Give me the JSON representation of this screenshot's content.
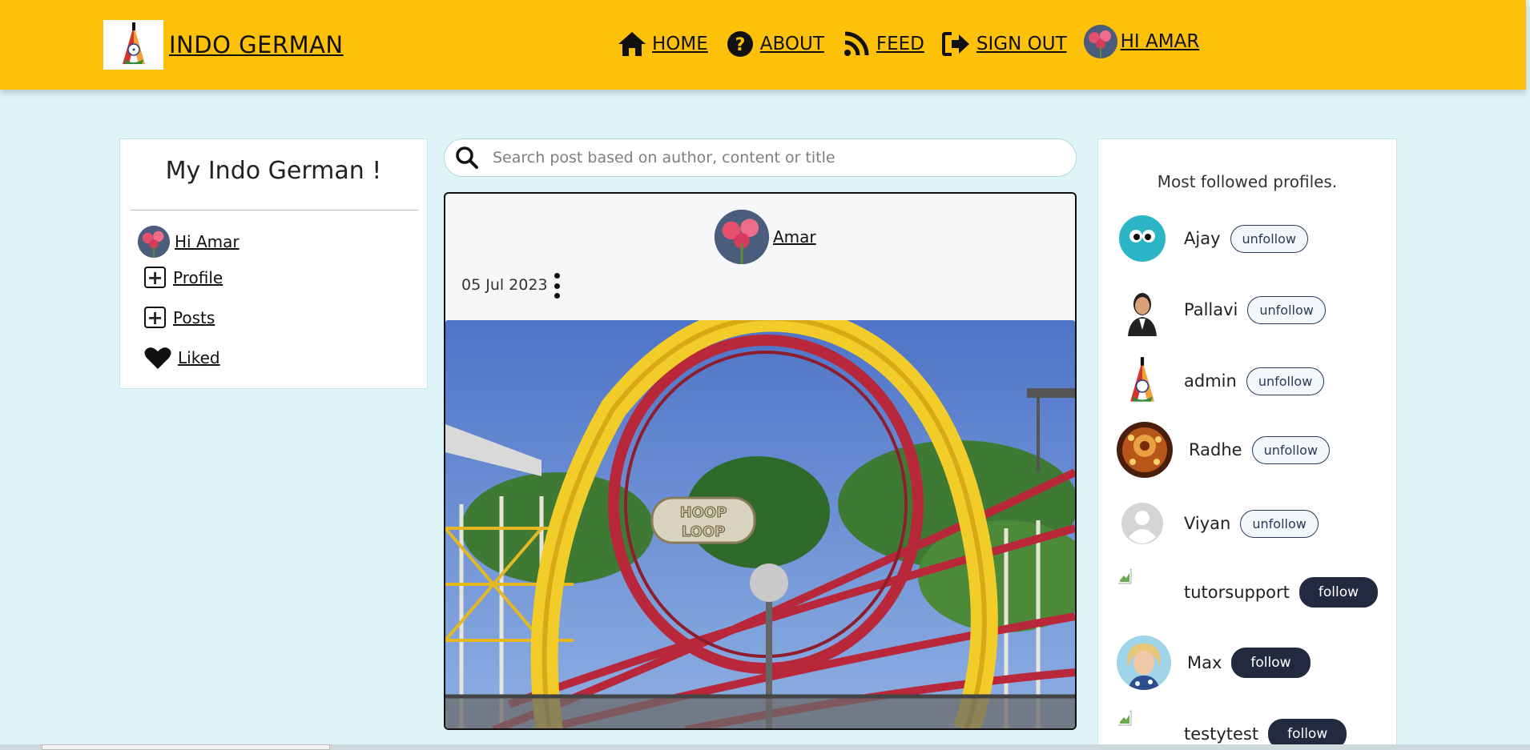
{
  "header": {
    "brand": "INDO GERMAN",
    "nav": [
      {
        "label": "HOME",
        "icon": "home-icon"
      },
      {
        "label": "ABOUT",
        "icon": "question-circle-icon"
      },
      {
        "label": "FEED",
        "icon": "rss-feed-icon"
      },
      {
        "label": "SIGN OUT",
        "icon": "sign-out-icon"
      }
    ],
    "user_greeting": " HI AMAR"
  },
  "sidebar": {
    "title": "My Indo German !",
    "user_link": " Hi Amar",
    "items": [
      {
        "label": "Profile",
        "icon": "plus-square-icon"
      },
      {
        "label": "Posts",
        "icon": "plus-square-icon"
      },
      {
        "label": "Liked",
        "icon": "heart-icon"
      }
    ]
  },
  "search": {
    "placeholder": "Search post based on author, content or title",
    "value": ""
  },
  "post": {
    "author": "Amar",
    "date": "05 Jul 2023",
    "image_alt": "roller coaster loop"
  },
  "profiles": {
    "title": "Most followed profiles.",
    "list": [
      {
        "name": "Ajay",
        "action": "unfollow"
      },
      {
        "name": "Pallavi",
        "action": "unfollow"
      },
      {
        "name": "admin",
        "action": "unfollow"
      },
      {
        "name": "Radhe",
        "action": "unfollow"
      },
      {
        "name": "Viyan",
        "action": "unfollow"
      },
      {
        "name": "tutorsupport",
        "action": "follow"
      },
      {
        "name": "Max",
        "action": "follow"
      },
      {
        "name": "testytest",
        "action": "follow"
      }
    ]
  },
  "colors": {
    "header_bg": "#fdc10a",
    "page_bg": "#def4f8",
    "follow_btn": "#212a3e"
  }
}
